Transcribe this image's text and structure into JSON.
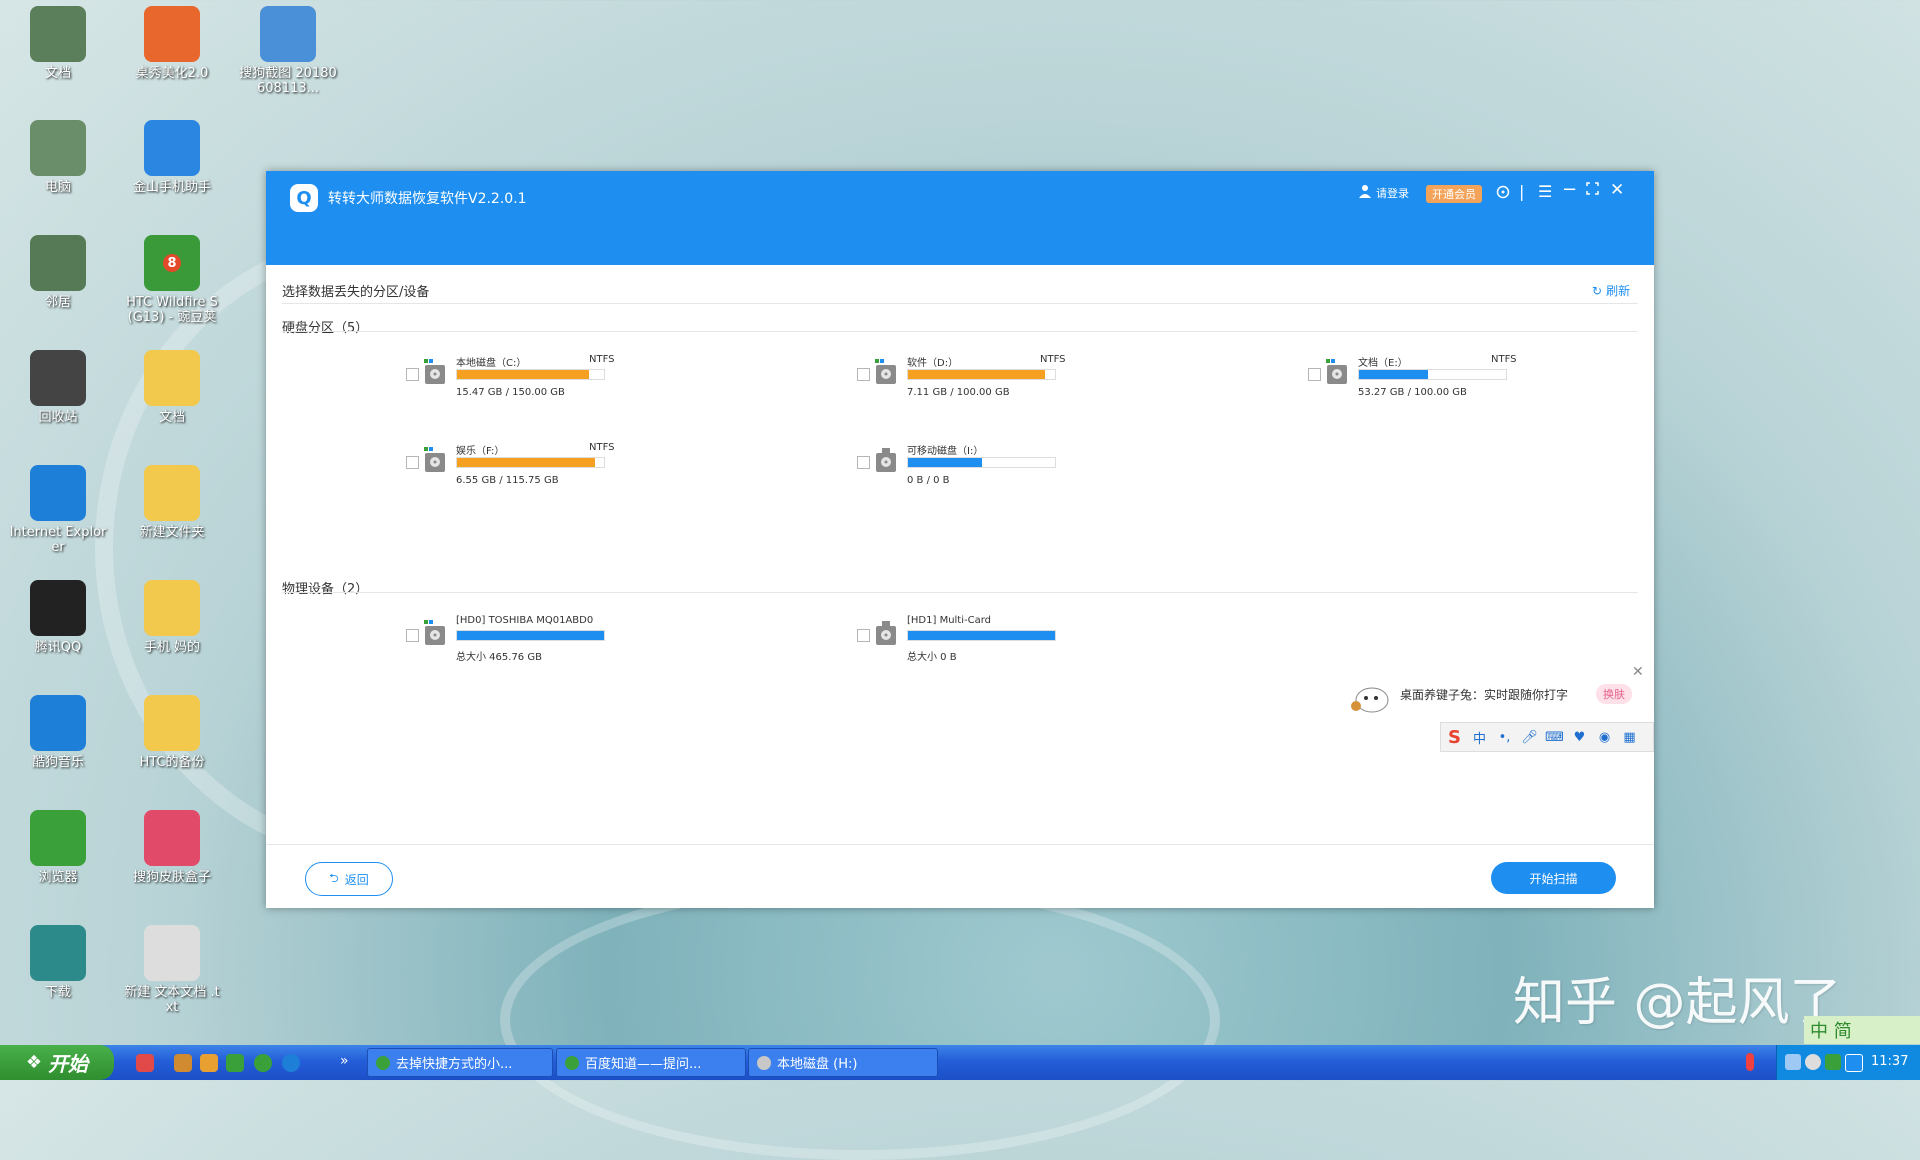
{
  "desktop": {
    "icons": [
      {
        "label": "文档",
        "icon": "computer-icon",
        "color": "#5a7f5a"
      },
      {
        "label": "桌秀美化2.0",
        "icon": "color-wheel-icon",
        "color": "#e8672c"
      },
      {
        "label": "搜狗截图 20180608113...",
        "icon": "image-file-icon",
        "color": "#4a90d9"
      },
      {
        "label": "电脑",
        "icon": "monitor-icon",
        "color": "#6a8d6a"
      },
      {
        "label": "金山手机助手",
        "icon": "phone-assistant-icon",
        "color": "#2a86e0"
      },
      {
        "label": "邻居",
        "icon": "network-icon",
        "color": "#567a55"
      },
      {
        "label": "HTC Wildfire S (G13) - 豌豆荚",
        "icon": "android-icon",
        "color": "#3a9a3a",
        "badge": "8"
      },
      {
        "label": "回收站",
        "icon": "recycle-bin-icon",
        "color": "#444444"
      },
      {
        "label": "文档",
        "icon": "folder-icon",
        "color": "#f2c94c"
      },
      {
        "label": "Internet Explorer",
        "icon": "ie-icon",
        "color": "#1e7fd8"
      },
      {
        "label": "新建文件夹",
        "icon": "folder-icon",
        "color": "#f2c94c"
      },
      {
        "label": "腾讯QQ",
        "icon": "qq-icon",
        "color": "#222222"
      },
      {
        "label": "手机 妈的",
        "icon": "folder-icon",
        "color": "#f2c94c"
      },
      {
        "label": "酷狗音乐",
        "icon": "kugou-icon",
        "color": "#1e7fd8"
      },
      {
        "label": "HTC的备份",
        "icon": "folder-icon",
        "color": "#f2c94c"
      },
      {
        "label": "浏览器",
        "icon": "browser-icon",
        "color": "#3aa13a"
      },
      {
        "label": "搜狗皮肤盒子",
        "icon": "skin-box-icon",
        "color": "#e24a6a"
      },
      {
        "label": "下载",
        "icon": "download-icon",
        "color": "#2d8a8a"
      },
      {
        "label": "新建 文本文档 .txt",
        "icon": "text-file-icon",
        "color": "#dddddd"
      }
    ]
  },
  "window": {
    "title": "转转大师数据恢复软件V2.2.0.1",
    "login_label": "请登录",
    "vip_label": "开通会员",
    "section_title": "选择数据丢失的分区/设备",
    "refresh_label": "刷新",
    "partitions_title": "硬盘分区（5）",
    "devices_title": "物理设备（2）",
    "back_label": "返回",
    "scan_label": "开始扫描"
  },
  "partitions": [
    {
      "name": "本地磁盘（C:）",
      "fs": "NTFS",
      "size": "15.47 GB / 150.00 GB",
      "fill": 0.9,
      "color": "#f5a020"
    },
    {
      "name": "软件（D:）",
      "fs": "NTFS",
      "size": "7.11 GB / 100.00 GB",
      "fill": 0.93,
      "color": "#f5a020"
    },
    {
      "name": "文档（E:）",
      "fs": "NTFS",
      "size": "53.27 GB / 100.00 GB",
      "fill": 0.47,
      "color": "#1e8ff0"
    },
    {
      "name": "娱乐（F:）",
      "fs": "NTFS",
      "size": "6.55 GB / 115.75 GB",
      "fill": 0.94,
      "color": "#f5a020"
    },
    {
      "name": "可移动磁盘（I:）",
      "fs": "",
      "size": "0 B / 0 B",
      "fill": 0.5,
      "color": "#1e8ff0"
    }
  ],
  "devices": [
    {
      "name": "[HD0] TOSHIBA MQ01ABD0",
      "size": "总大小 465.76 GB",
      "fill": 1.0,
      "color": "#1e8ff0"
    },
    {
      "name": "[HD1] Multi-Card",
      "size": "总大小 0 B",
      "fill": 1.0,
      "color": "#1e8ff0"
    }
  ],
  "ime": {
    "tip": "桌面养键子兔：实时跟随你打字",
    "skin_label": "换肤",
    "mode_label": "中"
  },
  "taskbar": {
    "start_label": "开始",
    "tasks": [
      {
        "label": "去掉快捷方式的小..."
      },
      {
        "label": "百度知道——提问..."
      },
      {
        "label": "本地磁盘 (H:)"
      }
    ],
    "time": "11:37"
  },
  "watermark": "知乎 @起风了",
  "lang_bar": "中 简"
}
